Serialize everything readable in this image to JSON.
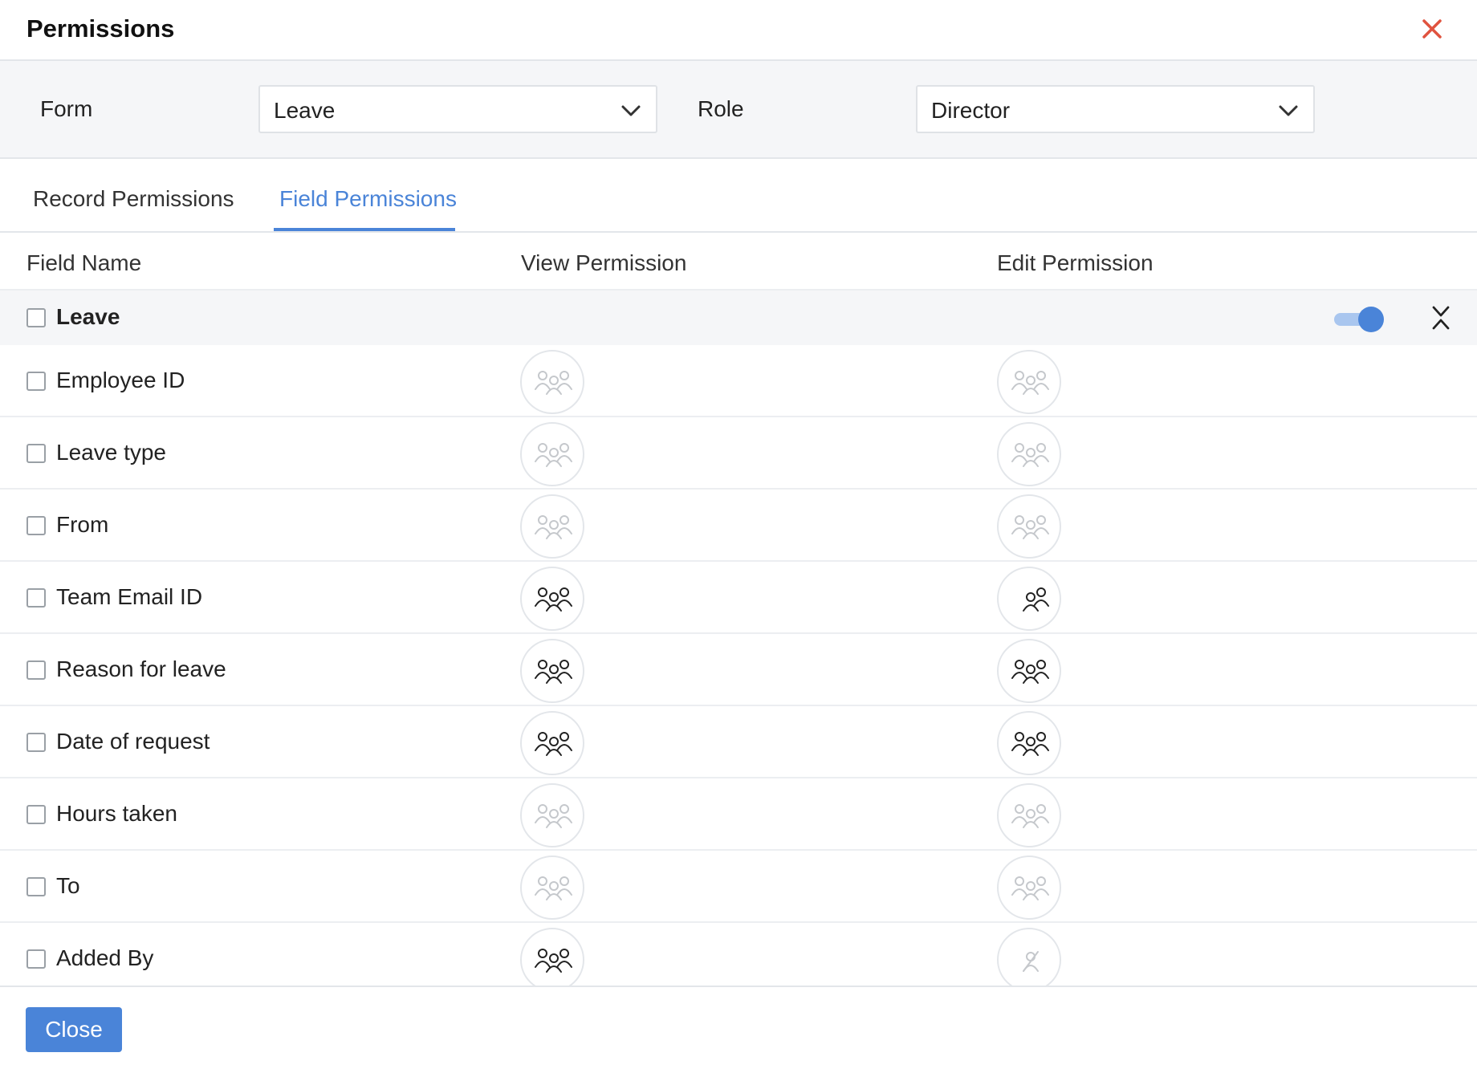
{
  "dialog": {
    "title": "Permissions"
  },
  "filters": {
    "form_label": "Form",
    "form_value": "Leave",
    "role_label": "Role",
    "role_value": "Director"
  },
  "tabs": [
    {
      "label": "Record Permissions",
      "active": false
    },
    {
      "label": "Field Permissions",
      "active": true
    }
  ],
  "columns": {
    "field_name": "Field Name",
    "view": "View Permission",
    "edit": "Edit Permission"
  },
  "group": {
    "name": "Leave",
    "toggle_on": true
  },
  "fields": [
    {
      "name": "Employee ID",
      "view": "disabled",
      "edit": "disabled"
    },
    {
      "name": "Leave type",
      "view": "disabled",
      "edit": "disabled"
    },
    {
      "name": "From",
      "view": "disabled",
      "edit": "disabled"
    },
    {
      "name": "Team Email ID",
      "view": "enabled",
      "edit": "enabled-partial"
    },
    {
      "name": "Reason for leave",
      "view": "enabled",
      "edit": "enabled"
    },
    {
      "name": "Date of request",
      "view": "enabled",
      "edit": "enabled"
    },
    {
      "name": "Hours taken",
      "view": "disabled",
      "edit": "disabled"
    },
    {
      "name": "To",
      "view": "disabled",
      "edit": "disabled"
    },
    {
      "name": "Added By",
      "view": "enabled",
      "edit": "none"
    }
  ],
  "footer": {
    "close_label": "Close"
  },
  "colors": {
    "accent": "#4a84d8",
    "close_x": "#e0533f",
    "icon_enabled": "#222222",
    "icon_disabled": "#c5c8cc"
  },
  "icons": {
    "permission": "users-group-icon",
    "no_permission": "user-off-icon"
  }
}
